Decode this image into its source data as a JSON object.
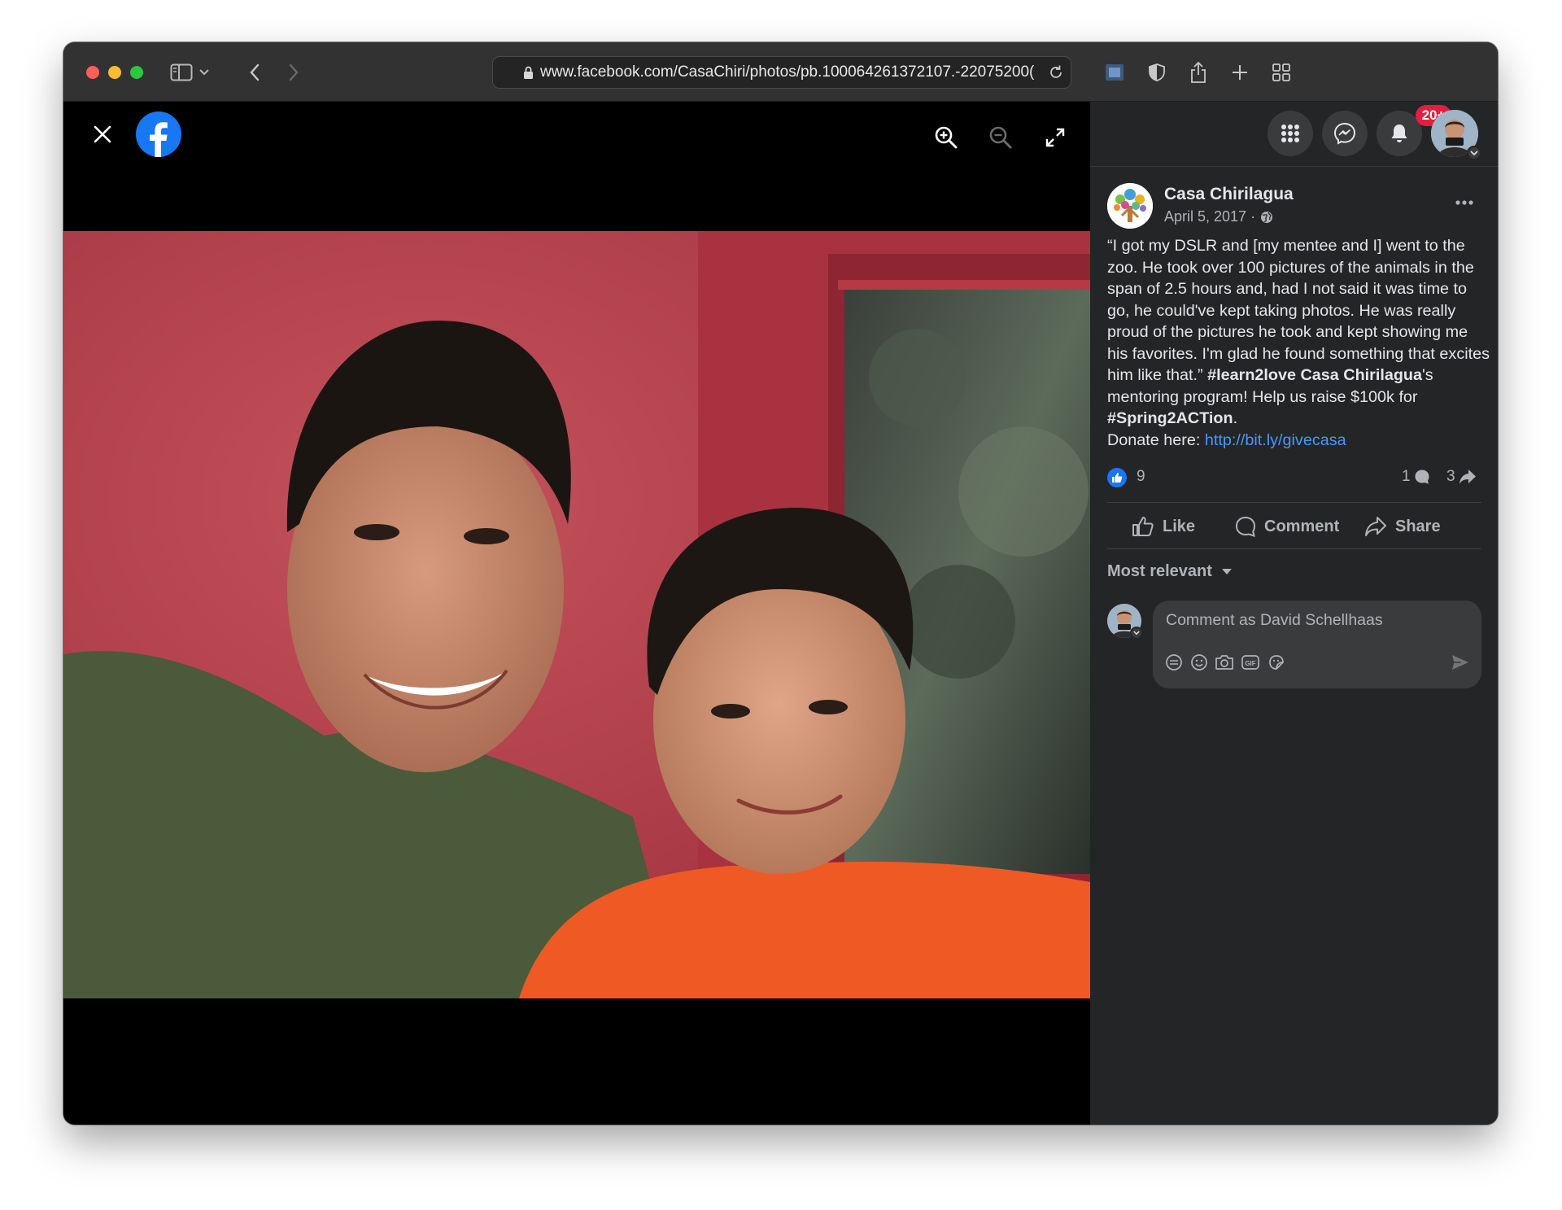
{
  "browser": {
    "url": "www.facebook.com/CasaChiri/photos/pb.100064261372107.-22075200("
  },
  "viewer": {
    "photo_alt": "Photo of a man and a boy smiling in front of a red door"
  },
  "header": {
    "notification_badge": "20+"
  },
  "post": {
    "page_name": "Casa Chirilagua",
    "date": "April 5, 2017 ·",
    "text_part1": "“I got my DSLR and [my mentee and I] went to the zoo. He took over 100 pictures of the animals in the span of 2.5 hours and, had I not said it was time to go, he could've kept taking photos. He was really proud of the pictures he took and kept showing me his favorites. I'm glad he found something that excites him like that.” ",
    "hashtag1": "#learn2love",
    "mention": "Casa Chirilagua",
    "text_part2": "'s mentoring program! Help us raise $100k for ",
    "hashtag2": "#Spring2ACTion",
    "text_part3": ".",
    "donate_label": "Donate here: ",
    "donate_link": "http://bit.ly/givecasa"
  },
  "stats": {
    "likes": "9",
    "comments": "1",
    "shares": "3"
  },
  "actions": {
    "like": "Like",
    "comment": "Comment",
    "share": "Share"
  },
  "comments": {
    "sort_label": "Most relevant",
    "placeholder": "Comment as David Schellhaas"
  },
  "colors": {
    "facebook_blue": "#1877f2",
    "panel_bg": "#242526",
    "badge_red": "#e41e3f",
    "link_blue": "#4599ff"
  },
  "icons": {
    "toolbar": [
      "sidebar-icon",
      "chevron-down-icon",
      "back-icon",
      "forward-icon",
      "lock-icon",
      "reload-icon",
      "extension-icon",
      "shield-icon",
      "share-icon",
      "new-tab-icon",
      "tab-overview-icon"
    ],
    "viewer": [
      "close-icon",
      "facebook-logo-icon",
      "zoom-in-icon",
      "zoom-out-icon",
      "fullscreen-icon"
    ],
    "header": [
      "menu-grid-icon",
      "messenger-icon",
      "bell-icon"
    ]
  }
}
